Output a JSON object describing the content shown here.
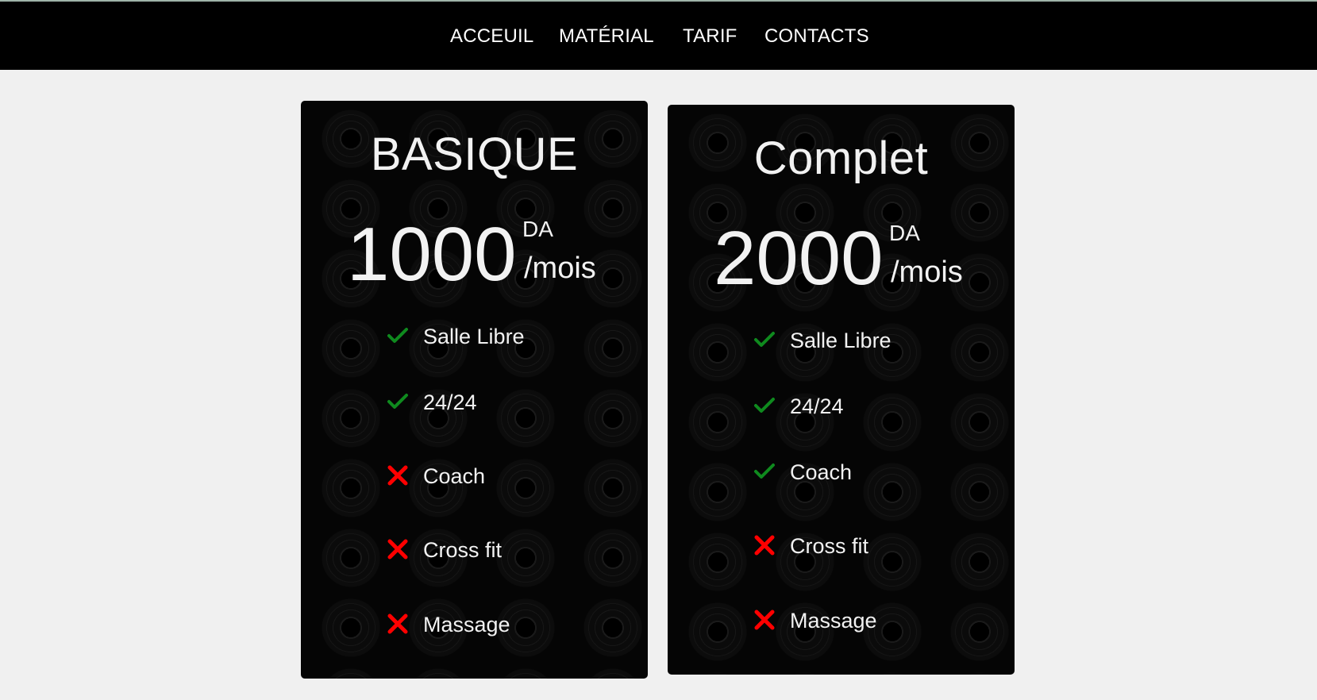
{
  "nav": {
    "items": [
      {
        "label": "ACCEUIL"
      },
      {
        "label": "MATÉRIAL"
      },
      {
        "label": "TARIF"
      },
      {
        "label": "CONTACTS"
      }
    ]
  },
  "colors": {
    "check": "#0f8a1e",
    "cross": "#ff0000",
    "card_background": "#050505",
    "nav_background": "#000000",
    "page_background": "#f0f0f0"
  },
  "plans": [
    {
      "title": "BASIQUE",
      "price": "1000",
      "currency": "DA",
      "period": "/mois",
      "features": [
        {
          "label": "Salle Libre",
          "icon": "check-icon"
        },
        {
          "label": "24/24",
          "icon": "check-icon"
        },
        {
          "label": "Coach",
          "icon": "cross-icon"
        },
        {
          "label": "Cross fit",
          "icon": "cross-icon"
        },
        {
          "label": "Massage",
          "icon": "cross-icon"
        }
      ]
    },
    {
      "title": "Complet",
      "price": "2000",
      "currency": "DA",
      "period": "/mois",
      "features": [
        {
          "label": "Salle Libre",
          "icon": "check-icon"
        },
        {
          "label": "24/24",
          "icon": "check-icon"
        },
        {
          "label": "Coach",
          "icon": "check-icon"
        },
        {
          "label": "Cross fit",
          "icon": "cross-icon"
        },
        {
          "label": "Massage",
          "icon": "cross-icon"
        }
      ]
    }
  ]
}
